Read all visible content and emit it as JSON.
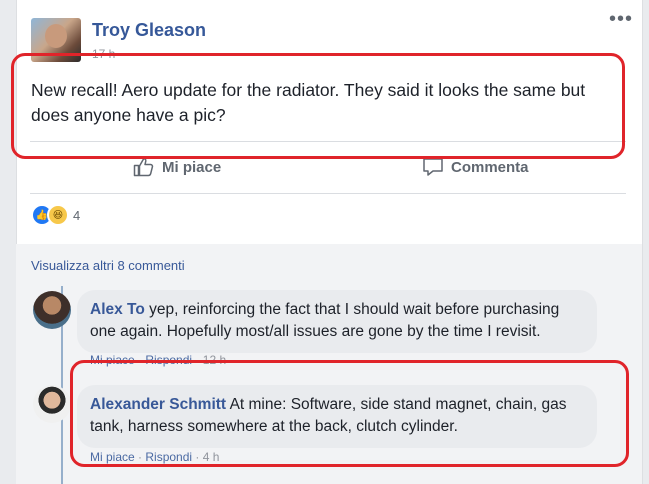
{
  "post": {
    "author": "Troy Gleason",
    "time": "17 h",
    "text": "New recall! Aero update for the radiator. They said it looks the same but does anyone have a pic?",
    "more_icon": "more-options-icon"
  },
  "actions": {
    "like_label": "Mi piace",
    "comment_label": "Commenta"
  },
  "reactions": {
    "count": "4",
    "types": [
      "like",
      "haha"
    ]
  },
  "comments_section": {
    "view_more": "Visualizza altri 8 commenti",
    "comments": [
      {
        "author": "Alex To",
        "text": "yep, reinforcing the fact that I should wait before purchasing one again. Hopefully most/all issues are gone by the time I revisit.",
        "like": "Mi piace",
        "reply": "Rispondi",
        "time": "12 h"
      },
      {
        "author": "Alexander Schmitt",
        "text": "At mine: Software, side stand magnet, chain, gas tank, harness somewhere at the back, clutch cylinder.",
        "like": "Mi piace",
        "reply": "Rispondi",
        "time": "4 h"
      }
    ]
  },
  "colors": {
    "link_blue": "#385898",
    "highlight_red": "#e0242a",
    "background": "#e9ebee"
  }
}
